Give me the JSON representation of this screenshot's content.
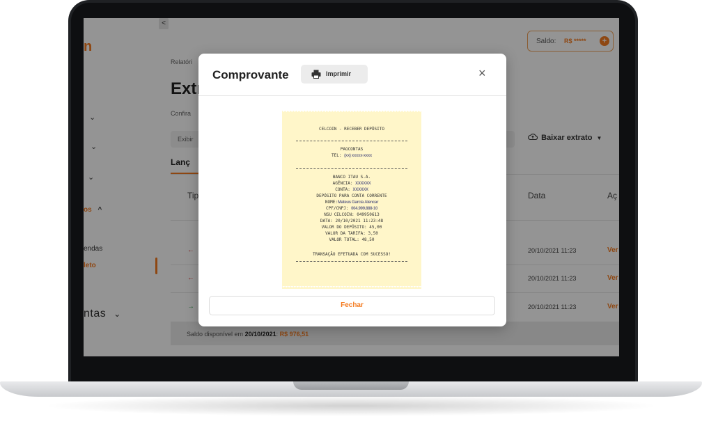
{
  "app": {
    "brand_fragment": "n",
    "collapse_glyph": "<"
  },
  "sidebar": {
    "partial_items": [
      {
        "text": "os",
        "chevron": "^"
      },
      {
        "text": "endas"
      },
      {
        "text": "leto"
      },
      {
        "text": "ntas",
        "chevron": "v"
      }
    ]
  },
  "header": {
    "saldo_label": "Saldo:",
    "saldo_value": "R$ *****",
    "saldo_add": "+"
  },
  "page": {
    "breadcrumb_fragment": "Relatóri",
    "title_fragment": "Extr",
    "subtitle_fragment": "Confira",
    "exibir_fragment": "Exibir",
    "tab_label_fragment": "Lanç",
    "download_label": "Baixar extrato",
    "columns": {
      "tipo_fragment": "Tip",
      "data": "Data",
      "acoes_fragment": "Aç"
    }
  },
  "table": {
    "rows": [
      {
        "arrow": "←",
        "arrow_color": "#e04b4b",
        "date": "20/10/2021 11:23",
        "action": "Ver"
      },
      {
        "arrow": "←",
        "arrow_color": "#e04b4b",
        "date": "20/10/2021 11:23",
        "action": "Ver"
      },
      {
        "arrow": "→",
        "arrow_color": "#3aa655",
        "date": "20/10/2021 11:23",
        "action": "Ver"
      }
    ],
    "footer_prefix": "Saldo disponível em ",
    "footer_date": "20/10/2021",
    "footer_colon": ": ",
    "footer_value": "R$ 976,51"
  },
  "modal": {
    "title": "Comprovante",
    "print_label": "Imprimir",
    "close_glyph": "×",
    "close_button_label": "Fechar",
    "receipt": {
      "header": "CELCOIN - RECEBER DEPÓSITO",
      "company": "PAGCONTAS",
      "tel_label": "TEL:",
      "tel_value": "(xx) xxxxx-xxxx",
      "bank": "BANCO ITAU S.A.",
      "agencia_label": "AGÊNCIA:",
      "agencia_value": "XXXXXX",
      "conta_label": "CONTA:",
      "conta_value": "XXXXXX",
      "deposit_type": "DEPÓSITO PARA CONTA CORRENTE",
      "nome_label": "NOME:",
      "nome_value": "Mateus Garcia Alencar",
      "cpf_label": "CPF/CNPJ:",
      "cpf_value": "004.999.888-10",
      "nsu": "NSU CELCOIN: 049950613",
      "data": "DATA: 20/10/2021 11:23:48",
      "valor_deposito": "VALOR DO DEPÓSITO: 45,00",
      "valor_tarifa": "VALOR DA TARIFA: 3,50",
      "valor_total": "VALOR TOTAL: 48,50",
      "success": "TRANSAÇÃO EFETUADA COM SUCESSO!"
    }
  },
  "colors": {
    "accent": "#f47b20",
    "overlay": "rgba(0,0,0,0.42)",
    "receipt_bg": "#fff6c9"
  }
}
